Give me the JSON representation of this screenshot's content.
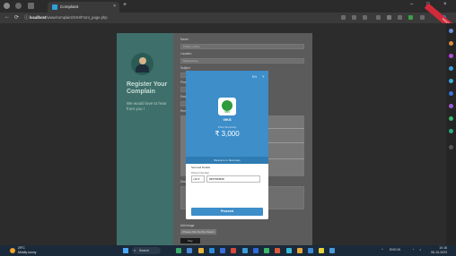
{
  "browser": {
    "tab_title": "Complaint",
    "tab_close": "×",
    "new_tab": "+",
    "window_controls": [
      "–",
      "□",
      "×"
    ],
    "url_host": "localhost",
    "url_path": "/www/complaint/SIH/Front_page.php",
    "nav": [
      "←",
      "⟳",
      "ⓘ"
    ]
  },
  "ribbon": {
    "text": "Incognito"
  },
  "form_left": {
    "heading": "Register Your Complain",
    "welcome": "We would love to hear from you !"
  },
  "form_right": {
    "labels": [
      "Name :",
      "Location:",
      "Subject",
      "Phone no.",
      "Email",
      "Remarks:",
      "Description"
    ],
    "name_value": "Pratik Londhe",
    "location_value": "Maharashtra",
    "choose_file": "Choose File",
    "no_file": "No file chosen",
    "file_label": "Add Image",
    "submit": "Pay"
  },
  "modal": {
    "lang": "EN",
    "close": "×",
    "logo_text": "VIKS",
    "merchant": "VIKS",
    "price_label": "Price Summary",
    "amount": "₹ 3,000",
    "strip_text": "Welcome to Razorpay",
    "secured": "Secured Details",
    "phone_label": "Phone Number",
    "country_code": "+91 ▾",
    "phone_value": "9657083838",
    "proceed": "Proceed"
  },
  "taskbar": {
    "weather_temp": "29°C",
    "weather_desc": "Mostly sunny",
    "search_placeholder": "Search",
    "lang": "ENG IN",
    "time": "10:18",
    "date": "06-10-2023"
  }
}
